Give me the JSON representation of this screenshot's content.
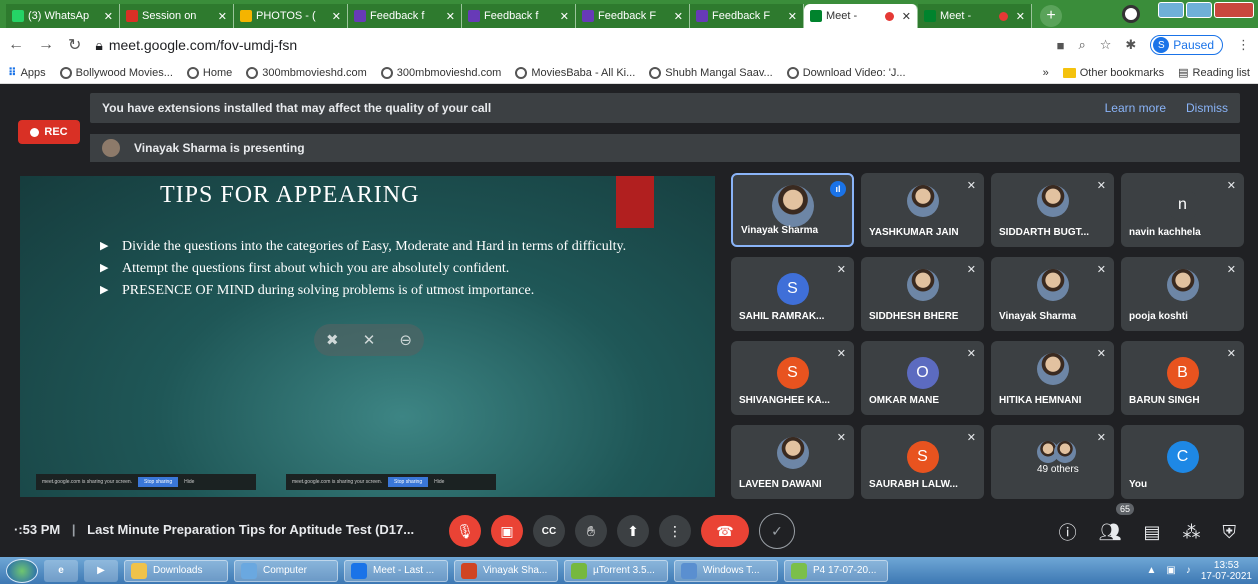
{
  "tabs": [
    {
      "label": "(3) WhatsAp",
      "icon": "whatsapp-icon",
      "color": "#25d366"
    },
    {
      "label": "Session on",
      "icon": "gmail-icon",
      "color": "#d93025"
    },
    {
      "label": "PHOTOS - (",
      "icon": "drive-icon",
      "color": "#f4b400"
    },
    {
      "label": "Feedback f",
      "icon": "forms-icon",
      "color": "#673ab7"
    },
    {
      "label": "Feedback f",
      "icon": "forms-icon",
      "color": "#673ab7"
    },
    {
      "label": "Feedback F",
      "icon": "forms-icon",
      "color": "#673ab7"
    },
    {
      "label": "Feedback F",
      "icon": "forms-icon",
      "color": "#673ab7"
    },
    {
      "label": "Meet -",
      "icon": "meet-icon",
      "color": "#00832d",
      "active": true
    },
    {
      "label": "Meet -",
      "icon": "meet-icon",
      "color": "#00832d"
    }
  ],
  "toolbar": {
    "url": "meet.google.com/fov-umdj-fsn",
    "profile_initial": "S",
    "profile_status": "Paused"
  },
  "bookmarks": {
    "apps": "Apps",
    "items": [
      "Bollywood Movies...",
      "Home",
      "300mbmovieshd.com",
      "300mbmovieshd.com",
      "MoviesBaba - All Ki...",
      "Shubh Mangal Saav...",
      "Download Video: 'J..."
    ],
    "more": "»",
    "other": "Other bookmarks",
    "reading": "Reading list"
  },
  "meet": {
    "banner_text": "You have extensions installed that may affect the quality of your call",
    "learn_more": "Learn more",
    "dismiss": "Dismiss",
    "rec_label": "REC",
    "presenting_text": "Vinayak Sharma is presenting"
  },
  "slide": {
    "title": "TIPS FOR APPEARING",
    "bullets": [
      "Divide the questions into the categories of Easy, Moderate and Hard in terms of difficulty.",
      "Attempt the questions first about which you are absolutely confident.",
      "PRESENCE OF MIND during solving problems is of utmost importance."
    ],
    "share_text": "meet.google.com is sharing your screen.",
    "stop_sharing": "Stop sharing",
    "hide": "Hide"
  },
  "participants": [
    {
      "name": "Vinayak Sharma",
      "type": "photo",
      "speaking": true
    },
    {
      "name": "YASHKUMAR JAIN",
      "type": "photo"
    },
    {
      "name": "SIDDARTH BUGT...",
      "type": "photo"
    },
    {
      "name": "navin kachhela",
      "type": "letter",
      "letter": "n",
      "color": "#3c4043"
    },
    {
      "name": "SAHIL RAMRAK...",
      "type": "letter",
      "letter": "S",
      "color": "#3f6fd8"
    },
    {
      "name": "SIDDHESH BHERE",
      "type": "photo"
    },
    {
      "name": "Vinayak Sharma",
      "type": "photo"
    },
    {
      "name": "pooja koshti",
      "type": "photo"
    },
    {
      "name": "SHIVANGHEE KA...",
      "type": "letter",
      "letter": "S",
      "color": "#e8531f"
    },
    {
      "name": "OMKAR MANE",
      "type": "letter",
      "letter": "O",
      "color": "#5c6bc0"
    },
    {
      "name": "HITIKA HEMNANI",
      "type": "photo"
    },
    {
      "name": "BARUN SINGH",
      "type": "letter",
      "letter": "B",
      "color": "#e8531f"
    },
    {
      "name": "LAVEEN DAWANI",
      "type": "photo"
    },
    {
      "name": "SAURABH LALW...",
      "type": "letter",
      "letter": "S",
      "color": "#e8531f"
    },
    {
      "name": "49 others",
      "type": "group"
    },
    {
      "name": "You",
      "type": "letter",
      "letter": "C",
      "color": "#1e88e5"
    }
  ],
  "bottom": {
    "time": "·:53 PM",
    "meeting_title": "Last Minute Preparation Tips for Aptitude Test (D17...",
    "participant_count": "65"
  },
  "taskbar": {
    "items": [
      {
        "label": "Downloads",
        "color": "#f0c24a"
      },
      {
        "label": "Computer",
        "color": "#6aa8e0"
      },
      {
        "label": "Meet - Last ...",
        "color": "#1a73e8"
      },
      {
        "label": "Vinayak Sha...",
        "color": "#d04423"
      },
      {
        "label": "µTorrent 3.5...",
        "color": "#76b83f"
      },
      {
        "label": "Windows T...",
        "color": "#5a8fd0"
      },
      {
        "label": "P4 17-07-20...",
        "color": "#7bbf4a"
      }
    ],
    "time": "13:53",
    "date": "17-07-2021"
  }
}
